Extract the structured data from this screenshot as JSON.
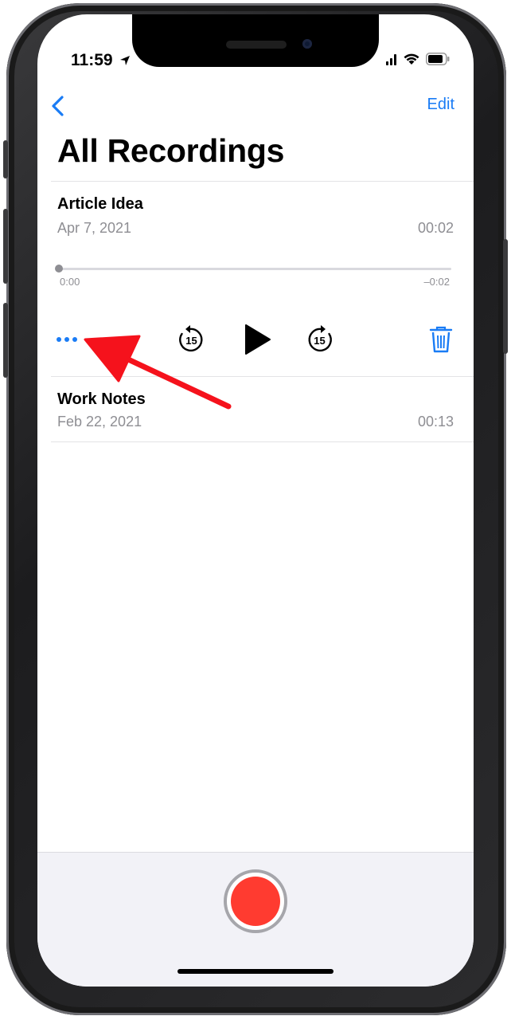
{
  "status_bar": {
    "time": "11:59"
  },
  "nav": {
    "edit_label": "Edit"
  },
  "page": {
    "title": "All Recordings"
  },
  "recordings": [
    {
      "name": "Article Idea",
      "date": "Apr 7, 2021",
      "duration": "00:02",
      "expanded": true,
      "player": {
        "elapsed": "0:00",
        "remaining": "–0:02",
        "progress": 0.0,
        "skip_seconds": "15"
      }
    },
    {
      "name": "Work Notes",
      "date": "Feb 22, 2021",
      "duration": "00:13",
      "expanded": false
    }
  ],
  "icons": {
    "back": "chevron-left-icon",
    "more": "ellipsis-icon",
    "skip_back": "skip-back-15-icon",
    "play": "play-icon",
    "skip_forward": "skip-forward-15-icon",
    "trash": "trash-icon",
    "record": "record-icon",
    "annotation": "red-arrow-annotation"
  },
  "colors": {
    "accent": "#1a7cf5",
    "record": "#ff3b30",
    "annotation_arrow": "#f5121c",
    "secondary_text": "#8e8e93"
  }
}
